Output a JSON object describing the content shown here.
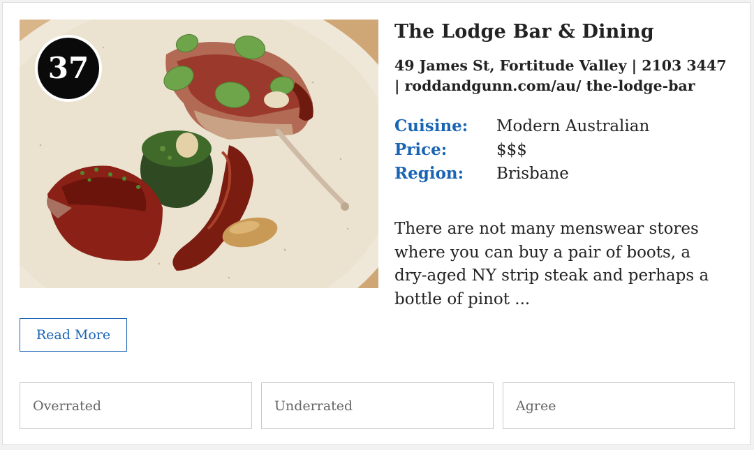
{
  "listing": {
    "rank": "37",
    "name": "The Lodge Bar & Dining",
    "address_line": "49 James St, Fortitude Valley | 2103 3447 | roddandgunn.com/au/ the-lodge-bar",
    "details": [
      {
        "label": "Cuisine:",
        "value": "Modern Australian"
      },
      {
        "label": "Price:",
        "value": "$$$"
      },
      {
        "label": "Region:",
        "value": "Brisbane"
      }
    ],
    "summary": "There are not many menswear stores where you can buy a pair of boots, a dry-aged NY strip steak and perhaps a bottle of pinot ...",
    "read_more_label": "Read More"
  },
  "votes": {
    "overrated": "Overrated",
    "underrated": "Underrated",
    "agree": "Agree"
  },
  "colors": {
    "accent": "#1a64b4",
    "text": "#222222",
    "badge": "#0a0a0a",
    "border": "#c9c9c9"
  },
  "image": {
    "subject": "plated lamb rack with spinach, jus and sauce on a speckled ceramic plate"
  }
}
